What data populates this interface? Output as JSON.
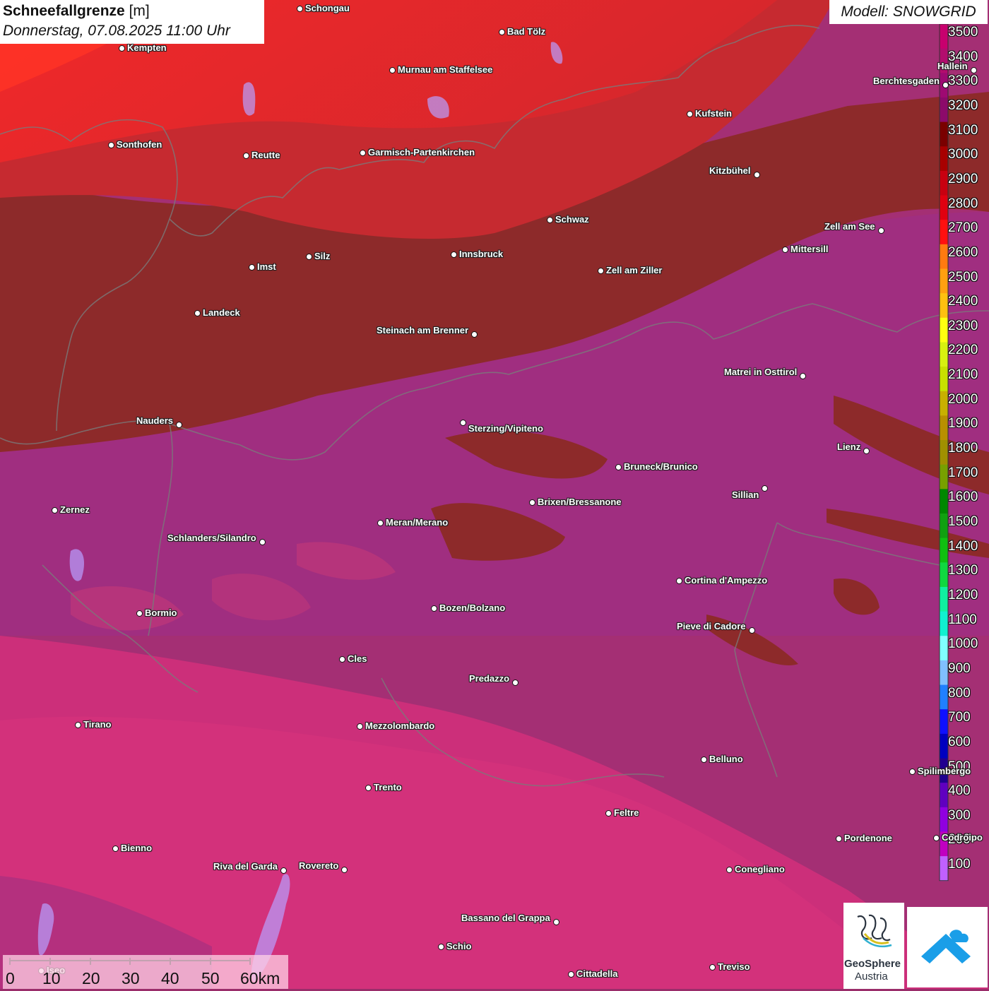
{
  "title": {
    "variable": "Schneefallgrenze",
    "unit": "[m]",
    "datetime": "Donnerstag, 07.08.2025 11:00 Uhr"
  },
  "model_label": "Modell: SNOWGRID",
  "legend": {
    "values": [
      "3500",
      "3400",
      "3300",
      "3200",
      "3100",
      "3000",
      "2900",
      "2800",
      "2700",
      "2600",
      "2500",
      "2400",
      "2300",
      "2200",
      "2100",
      "2000",
      "1900",
      "1800",
      "1700",
      "1600",
      "1500",
      "1400",
      "1300",
      "1200",
      "1100",
      "1000",
      "900",
      "800",
      "700",
      "600",
      "500",
      "400",
      "300",
      "200",
      "100"
    ],
    "colors": [
      "#c8006e",
      "#b30d6e",
      "#9e0a72",
      "#8c0a6a",
      "#7a0000",
      "#a80000",
      "#c80010",
      "#e00010",
      "#ff1010",
      "#ff7a10",
      "#ffa010",
      "#ffc010",
      "#ffff10",
      "#d8f010",
      "#c8e000",
      "#c8b000",
      "#b89000",
      "#a09000",
      "#78a000",
      "#008800",
      "#10a010",
      "#10c010",
      "#10d840",
      "#10f0a0",
      "#10f0d0",
      "#80ffff",
      "#80c0ff",
      "#2080ff",
      "#1010ff",
      "#0000c0",
      "#200090",
      "#6000c0",
      "#9000e0",
      "#c000c0",
      "#c060ff"
    ]
  },
  "cities": [
    {
      "name": "Schongau"
    },
    {
      "name": "Bad Tölz"
    },
    {
      "name": "Kempten"
    },
    {
      "name": "Murnau am Staffelsee"
    },
    {
      "name": "Hallein"
    },
    {
      "name": "Berchtesgaden"
    },
    {
      "name": "Kufstein"
    },
    {
      "name": "Sonthofen"
    },
    {
      "name": "Reutte"
    },
    {
      "name": "Garmisch-Partenkirchen"
    },
    {
      "name": "Kitzbühel"
    },
    {
      "name": "Schwaz"
    },
    {
      "name": "Zell am See"
    },
    {
      "name": "Mittersill"
    },
    {
      "name": "Innsbruck"
    },
    {
      "name": "Silz"
    },
    {
      "name": "Imst"
    },
    {
      "name": "Zell am Ziller"
    },
    {
      "name": "Landeck"
    },
    {
      "name": "Steinach am Brenner"
    },
    {
      "name": "Matrei in Osttirol"
    },
    {
      "name": "Nauders"
    },
    {
      "name": "Sterzing/Vipiteno"
    },
    {
      "name": "Lienz"
    },
    {
      "name": "Bruneck/Brunico"
    },
    {
      "name": "Sillian"
    },
    {
      "name": "Zernez"
    },
    {
      "name": "Brixen/Bressanone"
    },
    {
      "name": "Meran/Merano"
    },
    {
      "name": "Schlanders/Silandro"
    },
    {
      "name": "Cortina d'Ampezzo"
    },
    {
      "name": "Bozen/Bolzano"
    },
    {
      "name": "Bormio"
    },
    {
      "name": "Pieve di Cadore"
    },
    {
      "name": "Cles"
    },
    {
      "name": "Predazzo"
    },
    {
      "name": "Tirano"
    },
    {
      "name": "Mezzolombardo"
    },
    {
      "name": "Belluno"
    },
    {
      "name": "Spilimbergo"
    },
    {
      "name": "Trento"
    },
    {
      "name": "Feltre"
    },
    {
      "name": "Pordenone"
    },
    {
      "name": "Codroipo"
    },
    {
      "name": "Bienno"
    },
    {
      "name": "Riva del Garda"
    },
    {
      "name": "Rovereto"
    },
    {
      "name": "Conegliano"
    },
    {
      "name": "Bassano del Grappa"
    },
    {
      "name": "Schio"
    },
    {
      "name": "Treviso"
    },
    {
      "name": "Cittadella"
    },
    {
      "name": "Iseo"
    }
  ],
  "scale_bar": {
    "labels": [
      "0",
      "10",
      "20",
      "30",
      "40",
      "50",
      "60km"
    ]
  },
  "logos": {
    "geosphere_name": "GeoSphere",
    "geosphere_sub": "Austria"
  }
}
